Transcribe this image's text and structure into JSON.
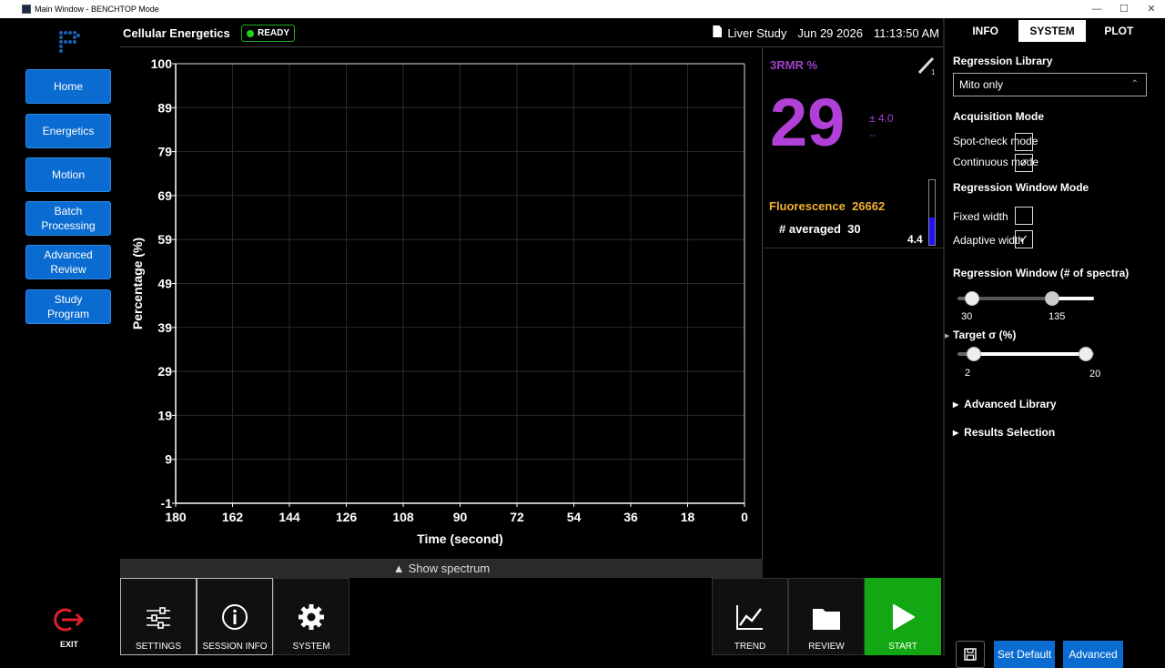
{
  "window": {
    "title": "Main Window - BENCHTOP Mode"
  },
  "sidebar": {
    "items": [
      {
        "label": "Home"
      },
      {
        "label": "Energetics"
      },
      {
        "label": "Motion"
      },
      {
        "label": "Batch Processing"
      },
      {
        "label": "Advanced Review"
      },
      {
        "label": "Study Program"
      }
    ],
    "exit_label": "EXIT"
  },
  "header": {
    "title": "Cellular Energetics",
    "status": "READY",
    "study": "Liver Study",
    "date": "Jun 29 2026",
    "time": "11:13:50 AM"
  },
  "chart_data": {
    "type": "line",
    "xlabel": "Time (second)",
    "ylabel": "Percentage (%)",
    "x_ticks": [
      "180",
      "162",
      "144",
      "126",
      "108",
      "90",
      "72",
      "54",
      "36",
      "18",
      "0"
    ],
    "y_ticks": [
      "100",
      "89",
      "79",
      "69",
      "59",
      "49",
      "39",
      "29",
      "19",
      "9",
      "-1"
    ],
    "xlim": [
      180,
      0
    ],
    "ylim": [
      -1,
      100
    ],
    "grid": true,
    "series": []
  },
  "show_spectrum": "Show spectrum",
  "readout": {
    "label": "3RMR %",
    "value": "29",
    "pm": "± 4.0",
    "dash": "--",
    "fluorescence_label": "Fluorescence",
    "fluorescence_value": "26662",
    "averaged_label": "# averaged",
    "averaged_value": "30",
    "gauge_value": "4.4",
    "gauge_level": 0.42
  },
  "panel": {
    "tabs": [
      "INFO",
      "SYSTEM",
      "PLOT"
    ],
    "active_tab": "SYSTEM",
    "regression_library_title": "Regression Library",
    "regression_library_value": "Mito only",
    "acquisition_mode_title": "Acquisition Mode",
    "spot_check_label": "Spot-check mode",
    "spot_check_checked": "",
    "continuous_label": "Continuous mode",
    "continuous_checked": "✓",
    "window_mode_title": "Regression Window Mode",
    "fixed_width_label": "Fixed width",
    "fixed_width_checked": "",
    "adaptive_width_label": "Adaptive width",
    "adaptive_width_checked": "✓",
    "regression_window_title": "Regression Window (# of spectra)",
    "regression_window_min": "30",
    "regression_window_max": "135",
    "target_sigma_title": "Target σ (%)",
    "target_sigma_min": "2",
    "target_sigma_max": "20",
    "advanced_library_label": "Advanced Library",
    "results_selection_label": "Results Selection",
    "set_default_label": "Set Default",
    "advanced_label": "Advanced"
  },
  "toolbar": {
    "settings_label": "SETTINGS",
    "session_info_label": "SESSION INFO",
    "system_label": "SYSTEM",
    "trend_label": "TREND",
    "review_label": "REVIEW",
    "start_label": "START"
  },
  "colors": {
    "nav_blue": "#0a6bd0",
    "rmr_purple": "#b040d8",
    "fluorescence_amber": "#f0b030",
    "start_green": "#13a813",
    "ready_green": "#1fd11f",
    "exit_red": "#e0202a"
  }
}
